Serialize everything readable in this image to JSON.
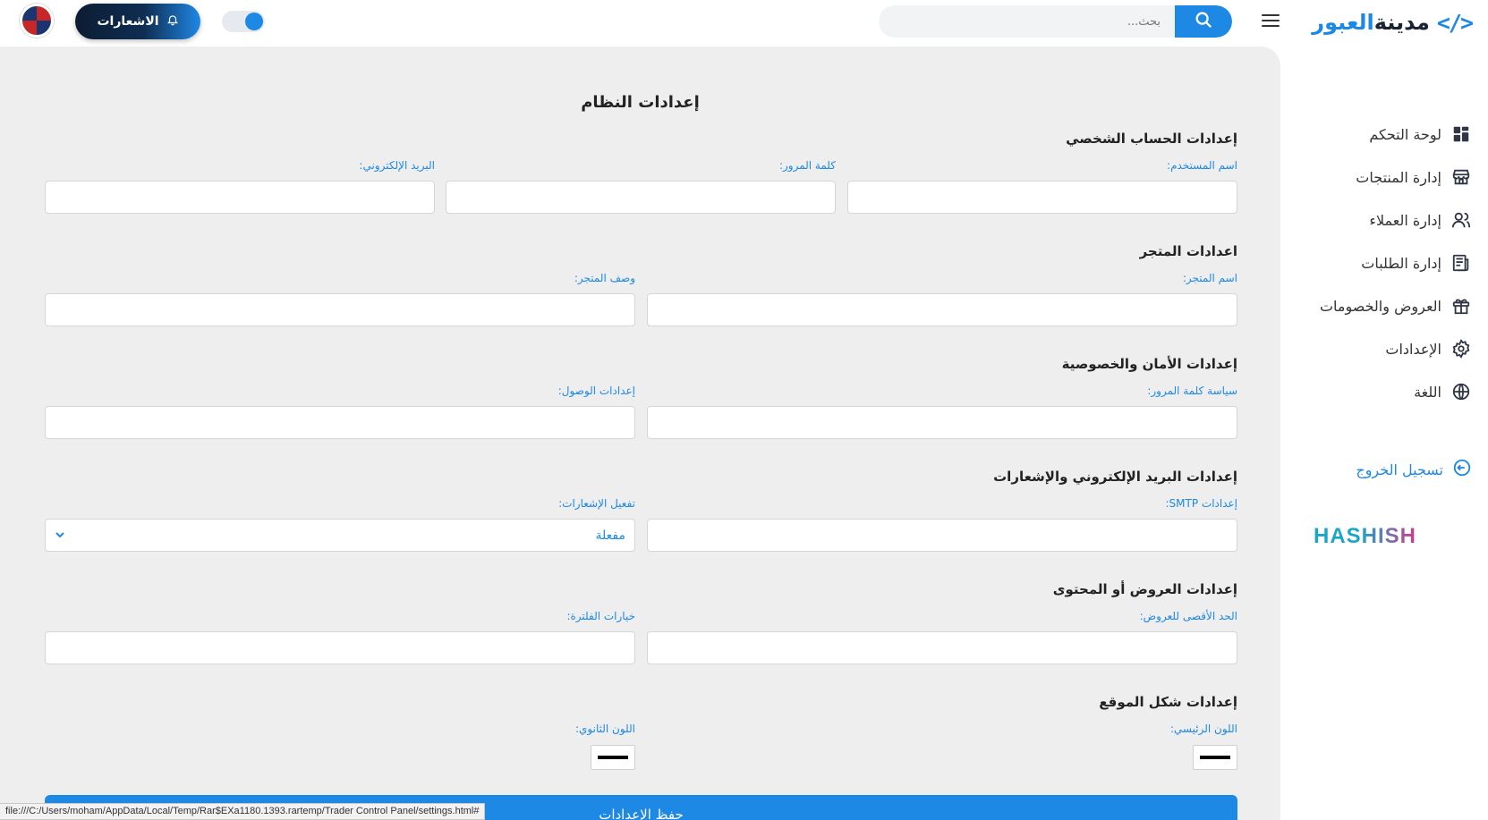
{
  "brand": {
    "code_symbol": "</>",
    "name_part1": "مدينة",
    "name_part2": "العبور"
  },
  "search": {
    "placeholder": "بحث..."
  },
  "header": {
    "notifications_label": "الاشعارات"
  },
  "sidebar": {
    "items": [
      {
        "label": "لوحة التحكم",
        "icon": "dashboard-icon"
      },
      {
        "label": "إدارة المنتجات",
        "icon": "store-icon"
      },
      {
        "label": "إدارة العملاء",
        "icon": "users-icon"
      },
      {
        "label": "إدارة الطلبات",
        "icon": "orders-icon"
      },
      {
        "label": "العروض والخصومات",
        "icon": "gift-icon"
      },
      {
        "label": "الإعدادات",
        "icon": "gear-icon"
      },
      {
        "label": "اللغة",
        "icon": "globe-icon"
      }
    ],
    "logout_label": "تسجيل الخروج",
    "footer_logo": "HASHISH"
  },
  "page": {
    "title": "إعدادات النظام",
    "sections": {
      "account": {
        "title": "إعدادات الحساب الشخصي",
        "username_label": "اسم المستخدم:",
        "password_label": "كلمة المرور:",
        "email_label": "البريد الإلكتروني:"
      },
      "store": {
        "title": "اعدادات المتجر",
        "store_name_label": "اسم المتجر:",
        "store_desc_label": "وصف المتجر:"
      },
      "security": {
        "title": "إعدادات الأمان والخصوصية",
        "password_policy_label": "سياسة كلمة المرور:",
        "access_label": "إعدادات الوصول:"
      },
      "email": {
        "title": "إعدادات البريد الإلكتروني والإشعارات",
        "smtp_label": "إعدادات SMTP:",
        "notifications_label": "تفعيل الإشعارات:",
        "notifications_value": "مفعلة"
      },
      "offers": {
        "title": "إعدادات العروض أو المحتوى",
        "max_offers_label": "الحد الأقصى للعروض:",
        "period_options_label": "خيارات الفلترة:"
      },
      "appearance": {
        "title": "إعدادات شكل الموقع",
        "primary_color_label": "اللون الرئيسي:",
        "secondary_color_label": "اللون الثانوي:",
        "primary_color": "#000000",
        "secondary_color": "#000000"
      }
    },
    "save_label": "حفظ الإعدادات"
  },
  "statusbar": {
    "url": "file:///C:/Users/moham/AppData/Local/Temp/Rar$EXa1180.1393.rartemp/Trader Control Panel/settings.html#"
  },
  "colors": {
    "accent": "#1e88e5",
    "main_bg": "#eeeeee",
    "notif_btn_dark": "#0b1d33"
  }
}
